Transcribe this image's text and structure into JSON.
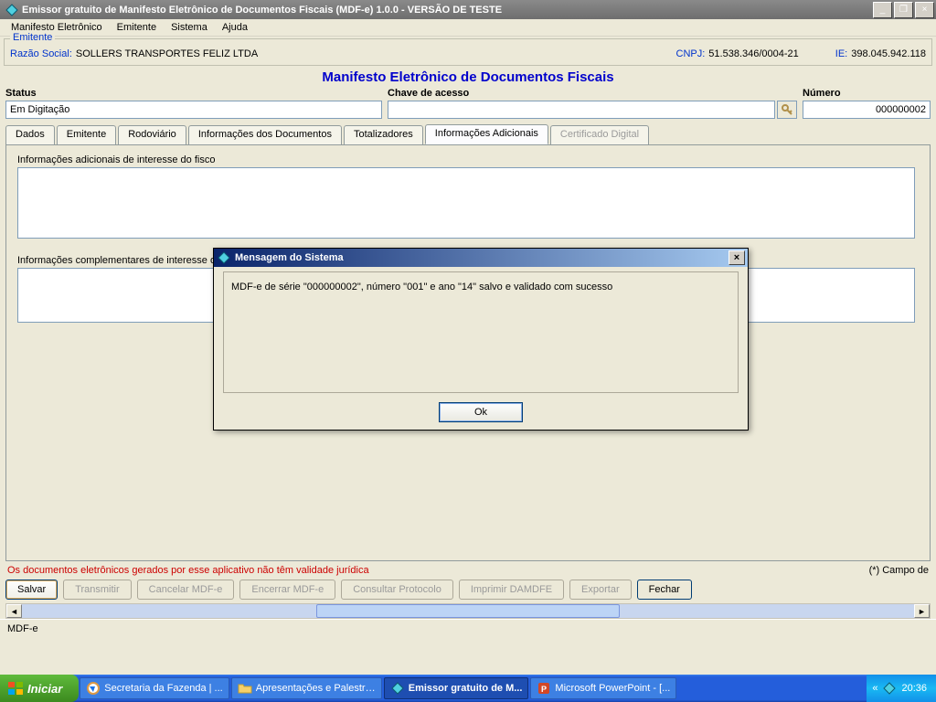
{
  "titlebar": {
    "text": "Emissor gratuito de Manifesto Eletrônico de Documentos Fiscais (MDF-e) 1.0.0 - VERSÃO DE TESTE"
  },
  "menubar": {
    "items": [
      "Manifesto Eletrônico",
      "Emitente",
      "Sistema",
      "Ajuda"
    ]
  },
  "emitente": {
    "legend": "Emitente",
    "razao_label": "Razão Social:",
    "razao_value": "SOLLERS TRANSPORTES FELIZ LTDA",
    "cnpj_label": "CNPJ:",
    "cnpj_value": "51.538.346/0004-21",
    "ie_label": "IE:",
    "ie_value": "398.045.942.118"
  },
  "page_heading": "Manifesto Eletrônico de Documentos Fiscais",
  "status_block": {
    "status_label": "Status",
    "status_value": "Em Digitação",
    "chave_label": "Chave de acesso",
    "chave_value": "",
    "numero_label": "Número",
    "numero_value": "000000002"
  },
  "tabs": {
    "items": [
      {
        "label": "Dados",
        "active": false,
        "disabled": false
      },
      {
        "label": "Emitente",
        "active": false,
        "disabled": false
      },
      {
        "label": "Rodoviário",
        "active": false,
        "disabled": false
      },
      {
        "label": "Informações dos Documentos",
        "active": false,
        "disabled": false
      },
      {
        "label": "Totalizadores",
        "active": false,
        "disabled": false
      },
      {
        "label": "Informações Adicionais",
        "active": true,
        "disabled": false
      },
      {
        "label": "Certificado Digital",
        "active": false,
        "disabled": true
      }
    ]
  },
  "panel": {
    "fisco_label": "Informações adicionais de interesse do fisco",
    "contrib_label": "Informações complementares de interesse do contribuinte"
  },
  "dialog": {
    "title": "Mensagem do Sistema",
    "body": "MDF-e de série \"000000002\", número \"001\" e ano \"14\" salvo e validado com sucesso",
    "ok_label": "Ok"
  },
  "footer": {
    "warning": "Os documentos eletrônicos gerados por esse aplicativo não têm validade jurídica",
    "campo_label": "(*) Campo de",
    "buttons": [
      {
        "label": "Salvar",
        "state": "default"
      },
      {
        "label": "Transmitir",
        "state": "disabled"
      },
      {
        "label": "Cancelar MDF-e",
        "state": "disabled"
      },
      {
        "label": "Encerrar MDF-e",
        "state": "disabled"
      },
      {
        "label": "Consultar Protocolo",
        "state": "disabled"
      },
      {
        "label": "Imprimir DAMDFE",
        "state": "disabled"
      },
      {
        "label": "Exportar",
        "state": "disabled"
      },
      {
        "label": "Fechar",
        "state": "plain-default"
      }
    ]
  },
  "app_status": "MDF-e",
  "taskbar": {
    "start": "Iniciar",
    "items": [
      {
        "label": "Secretaria da Fazenda | ...",
        "active": false
      },
      {
        "label": "Apresentações e Palestras",
        "active": false
      },
      {
        "label": "Emissor gratuito de M...",
        "active": true
      },
      {
        "label": "Microsoft PowerPoint - [...",
        "active": false
      }
    ],
    "clock": "20:36"
  },
  "icons": {
    "app_diamond": "◆",
    "key": "🔑",
    "chevrons": "«"
  }
}
